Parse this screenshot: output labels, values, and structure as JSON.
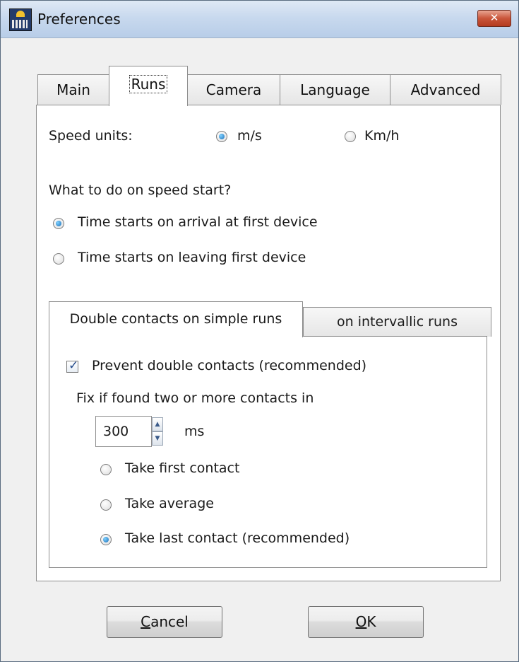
{
  "window": {
    "title": "Preferences",
    "close_glyph": "✕"
  },
  "tabs": [
    {
      "label": "Main"
    },
    {
      "label": "Runs",
      "active": true
    },
    {
      "label": "Camera"
    },
    {
      "label": "Language"
    },
    {
      "label": "Advanced"
    }
  ],
  "speed_units": {
    "label": "Speed units:",
    "options": [
      {
        "label": "m/s",
        "checked": true
      },
      {
        "label": "Km/h",
        "checked": false
      }
    ]
  },
  "speed_start": {
    "question": "What to do on speed start?",
    "options": [
      {
        "label": "Time starts on arrival at first device",
        "checked": true
      },
      {
        "label": "Time starts on leaving first device",
        "checked": false
      }
    ]
  },
  "double_contacts_tabs": [
    {
      "label": "Double contacts on simple runs",
      "active": true
    },
    {
      "label": "on intervallic runs",
      "active": false
    }
  ],
  "double_contacts": {
    "prevent_label": "Prevent double contacts (recommended)",
    "prevent_checked": true,
    "fix_label": "Fix if found two or more contacts in",
    "threshold_value": "300",
    "threshold_unit": "ms",
    "options": [
      {
        "label": "Take first contact",
        "checked": false
      },
      {
        "label": "Take average",
        "checked": false
      },
      {
        "label": "Take last contact (recommended)",
        "checked": true
      }
    ]
  },
  "buttons": {
    "cancel": {
      "mnemonic": "C",
      "rest": "ancel"
    },
    "ok": {
      "mnemonic": "O",
      "rest": "K"
    }
  }
}
